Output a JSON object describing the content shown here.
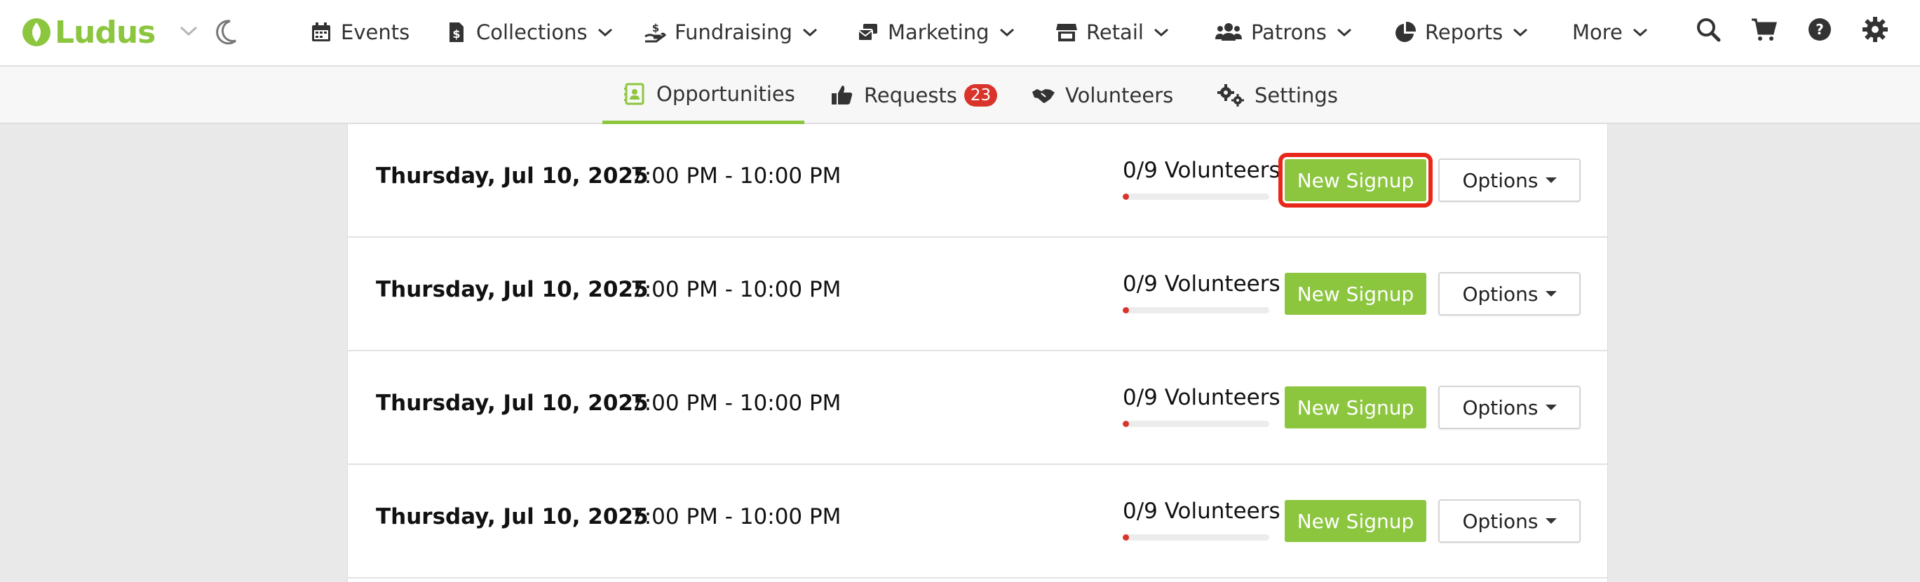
{
  "brand": {
    "name": "Ludus",
    "accent": "#8cc63f"
  },
  "topnav": {
    "items": [
      {
        "label": "Events",
        "icon": "calendar-icon"
      },
      {
        "label": "Collections",
        "icon": "dollar-file-icon"
      },
      {
        "label": "Fundraising",
        "icon": "donate-hand-icon"
      },
      {
        "label": "Marketing",
        "icon": "mail-bulk-icon"
      },
      {
        "label": "Retail",
        "icon": "store-icon"
      },
      {
        "label": "Patrons",
        "icon": "users-icon"
      },
      {
        "label": "Reports",
        "icon": "pie-chart-icon"
      },
      {
        "label": "More",
        "icon": ""
      }
    ],
    "tools": [
      "search-icon",
      "cart-icon",
      "help-icon",
      "gear-icon"
    ]
  },
  "subnav": {
    "tabs": [
      {
        "label": "Opportunities",
        "icon": "contact-card-icon",
        "active": true
      },
      {
        "label": "Requests",
        "badge": "23",
        "icon": "thumbs-up-icon"
      },
      {
        "label": "Volunteers",
        "icon": "handshake-icon"
      },
      {
        "label": "Settings",
        "icon": "cogs-icon"
      }
    ]
  },
  "rows": [
    {
      "date": "Thursday, Jul 10, 2025",
      "time": "7:00 PM - 10:00 PM",
      "volunteers": "0/9 Volunteers",
      "fill_ratio": 0,
      "signup_label": "New Signup",
      "options_label": "Options"
    },
    {
      "date": "Thursday, Jul 10, 2025",
      "time": "7:00 PM - 10:00 PM",
      "volunteers": "0/9 Volunteers",
      "fill_ratio": 0,
      "signup_label": "New Signup",
      "options_label": "Options"
    },
    {
      "date": "Thursday, Jul 10, 2025",
      "time": "7:00 PM - 10:00 PM",
      "volunteers": "0/9 Volunteers",
      "fill_ratio": 0,
      "signup_label": "New Signup",
      "options_label": "Options"
    },
    {
      "date": "Thursday, Jul 10, 2025",
      "time": "7:00 PM - 10:00 PM",
      "volunteers": "0/9 Volunteers",
      "fill_ratio": 0,
      "signup_label": "New Signup",
      "options_label": "Options"
    }
  ],
  "colors": {
    "progress": "#d9342b",
    "highlight": "#e8271b",
    "badge": "#d9342b"
  }
}
